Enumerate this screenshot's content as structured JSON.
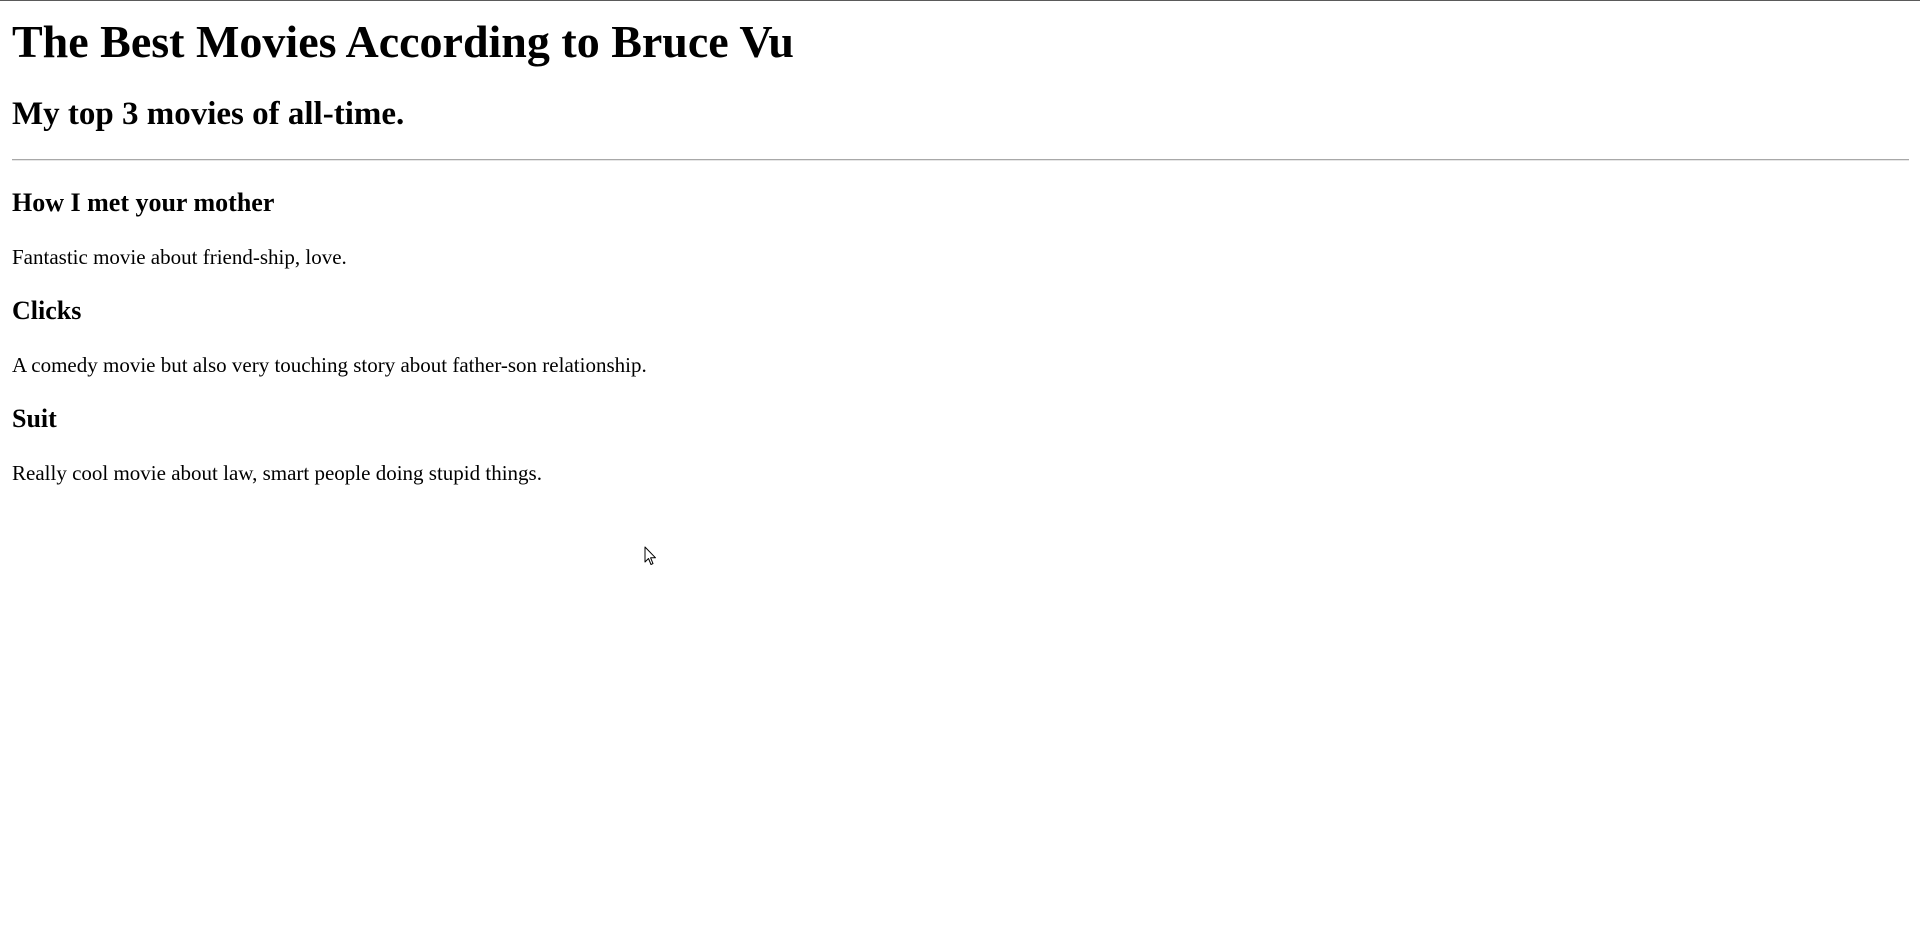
{
  "header": {
    "title": "The Best Movies According to Bruce Vu",
    "subtitle": "My top 3 movies of all-time."
  },
  "movies": [
    {
      "title": "How I met your mother",
      "description": "Fantastic movie about friend-ship, love."
    },
    {
      "title": "Clicks",
      "description": "A comedy movie but also very touching story about father-son relationship."
    },
    {
      "title": "Suit",
      "description": "Really cool movie about law, smart people doing stupid things."
    }
  ]
}
